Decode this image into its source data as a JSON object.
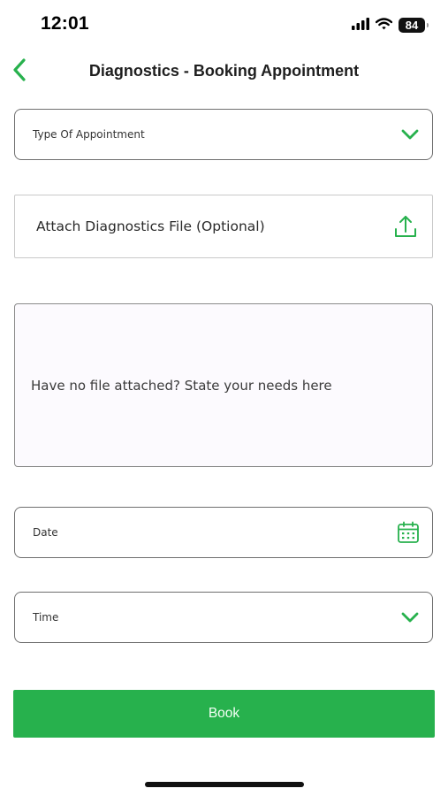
{
  "status_bar": {
    "time": "12:01",
    "battery_level": "84",
    "icons": [
      "cellular-signal-icon",
      "wifi-icon",
      "battery-icon"
    ]
  },
  "header": {
    "back_icon": "chevron-left-icon",
    "title": "Diagnostics - Booking Appointment"
  },
  "form": {
    "appointment_type": {
      "label": "Type Of Appointment",
      "icon": "chevron-down-icon"
    },
    "attach_file": {
      "label": "Attach Diagnostics File (Optional)",
      "icon": "upload-icon"
    },
    "needs": {
      "placeholder": "Have no file attached? State your needs here"
    },
    "date": {
      "label": "Date",
      "icon": "calendar-icon"
    },
    "time": {
      "label": "Time",
      "icon": "chevron-down-icon"
    },
    "book_button": {
      "label": "Book"
    }
  },
  "colors": {
    "accent": "#27b14d",
    "button_text": "#f4fff6",
    "field_border": "#6f6f6f",
    "textarea_bg": "#fcfafe"
  }
}
